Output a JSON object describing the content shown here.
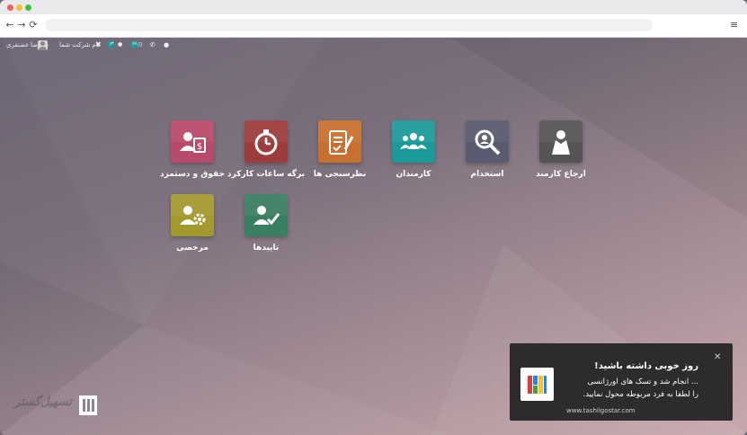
{
  "browser": {
    "back": "←",
    "forward": "→",
    "reload": "⟳",
    "menu": "≡"
  },
  "systray": {
    "user_name": "علیرضا غضنفری",
    "company_name": "نام شرکت شما",
    "chat_count": "۱۳",
    "activity_count": "۶۶"
  },
  "apps": [
    {
      "label": "ارجاع کارمند",
      "color": "#555354",
      "icon": "person-cape-icon"
    },
    {
      "label": "استخدام",
      "color": "#5a5a70",
      "icon": "magnifier-person-icon"
    },
    {
      "label": "کارمندان",
      "color": "#1c9a9a",
      "icon": "people-group-icon"
    },
    {
      "label": "نظرسنجی ها",
      "color": "#c8702f",
      "icon": "clipboard-pen-icon"
    },
    {
      "label": "برگه ساعات کارکرد",
      "color": "#9e3b3b",
      "icon": "stopwatch-icon"
    },
    {
      "label": "حقوق و دستمزد",
      "color": "#b84a6a",
      "icon": "payroll-person-icon"
    },
    {
      "label": "تاییدها",
      "color": "#3a7f62",
      "icon": "person-check-icon"
    },
    {
      "label": "مرخصی",
      "color": "#a39a2e",
      "icon": "person-gear-icon"
    }
  ],
  "notification": {
    "close": "✕",
    "title": "روز خوبی داشته باشید!",
    "line1": "... انجام شد و تسک های اورژانسی",
    "line2": "را لطفا به فرد مربوطه محول نمایید.",
    "url": "www.tashilgostar.com"
  },
  "watermark": {
    "text": "تسهیل‌گستر"
  }
}
